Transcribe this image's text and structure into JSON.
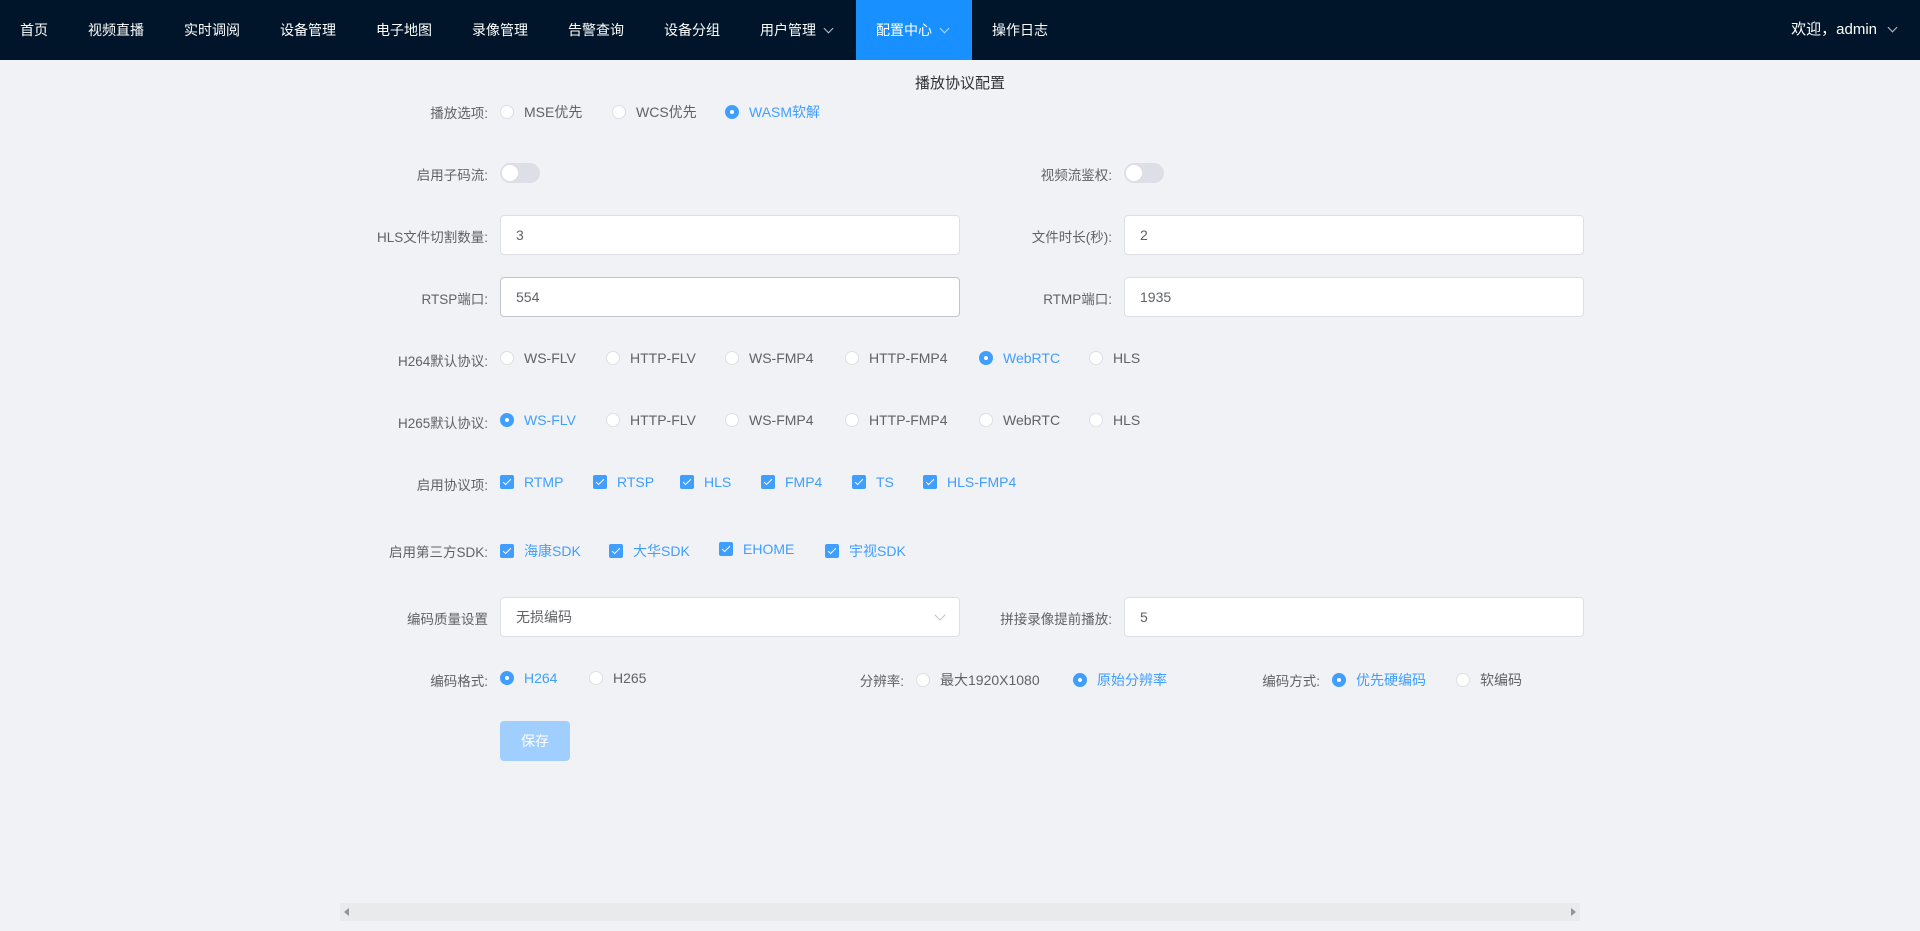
{
  "nav": {
    "items": [
      {
        "label": "首页"
      },
      {
        "label": "视频直播"
      },
      {
        "label": "实时调阅"
      },
      {
        "label": "设备管理"
      },
      {
        "label": "电子地图"
      },
      {
        "label": "录像管理"
      },
      {
        "label": "告警查询"
      },
      {
        "label": "设备分组"
      },
      {
        "label": "用户管理",
        "has_dropdown": true
      },
      {
        "label": "配置中心",
        "has_dropdown": true,
        "active": true
      },
      {
        "label": "操作日志"
      }
    ],
    "user": "欢迎，admin"
  },
  "page_title": "播放协议配置",
  "form": {
    "play_option": {
      "label": "播放选项:",
      "options": [
        "MSE优先",
        "WCS优先",
        "WASM软解"
      ],
      "selected": "WASM软解"
    },
    "sub_stream": {
      "label": "启用子码流:",
      "on": false
    },
    "stream_auth": {
      "label": "视频流鉴权:",
      "on": false
    },
    "hls_segments": {
      "label": "HLS文件切割数量:",
      "value": "3"
    },
    "file_duration": {
      "label": "文件时长(秒):",
      "value": "2"
    },
    "rtsp_port": {
      "label": "RTSP端口:",
      "value": "554"
    },
    "rtmp_port": {
      "label": "RTMP端口:",
      "value": "1935"
    },
    "h264_protocol": {
      "label": "H264默认协议:",
      "options": [
        "WS-FLV",
        "HTTP-FLV",
        "WS-FMP4",
        "HTTP-FMP4",
        "WebRTC",
        "HLS"
      ],
      "selected": "WebRTC"
    },
    "h265_protocol": {
      "label": "H265默认协议:",
      "options": [
        "WS-FLV",
        "HTTP-FLV",
        "WS-FMP4",
        "HTTP-FMP4",
        "WebRTC",
        "HLS"
      ],
      "selected": "WS-FLV"
    },
    "enabled_protocols": {
      "label": "启用协议项:",
      "options": [
        "RTMP",
        "RTSP",
        "HLS",
        "FMP4",
        "TS",
        "HLS-FMP4"
      ],
      "checked": [
        "RTMP",
        "RTSP",
        "HLS",
        "FMP4",
        "TS",
        "HLS-FMP4"
      ]
    },
    "third_party_sdk": {
      "label": "启用第三方SDK:",
      "options": [
        "海康SDK",
        "大华SDK",
        "EHOME",
        "宇视SDK"
      ],
      "checked": [
        "海康SDK",
        "大华SDK",
        "EHOME",
        "宇视SDK"
      ]
    },
    "encode_quality": {
      "label": "编码质量设置",
      "value": "无损编码"
    },
    "splice_preplay": {
      "label": "拼接录像提前播放:",
      "value": "5"
    },
    "encode_format": {
      "label": "编码格式:",
      "options": [
        "H264",
        "H265"
      ],
      "selected": "H264"
    },
    "resolution": {
      "label": "分辨率:",
      "options": [
        "最大1920X1080",
        "原始分辨率"
      ],
      "selected": "原始分辨率"
    },
    "encode_method": {
      "label": "编码方式:",
      "options": [
        "优先硬编码",
        "软编码"
      ],
      "selected": "优先硬编码"
    },
    "save_label": "保存"
  },
  "colors": {
    "nav_bg": "#001529",
    "nav_active": "#1890ff",
    "primary": "#409eff",
    "page_bg": "#f0f2f5"
  }
}
